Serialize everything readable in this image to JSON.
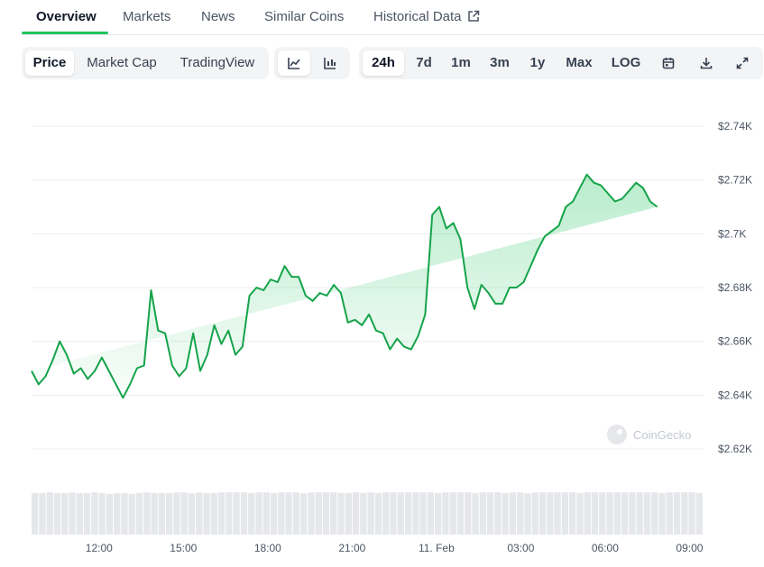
{
  "tabs": {
    "overview": "Overview",
    "markets": "Markets",
    "news": "News",
    "similar_coins": "Similar Coins",
    "historical_data": "Historical Data"
  },
  "toolbar": {
    "price": "Price",
    "market_cap": "Market Cap",
    "tradingview": "TradingView",
    "ranges": [
      "24h",
      "7d",
      "1m",
      "3m",
      "1y",
      "Max"
    ],
    "active_range": "24h",
    "log": "LOG",
    "icons": [
      "line-chart-icon",
      "candlestick-icon",
      "calendar-icon",
      "download-icon",
      "fullscreen-icon"
    ]
  },
  "watermark": "CoinGecko",
  "colors": {
    "line": "#16a34a",
    "accent": "#22c55e",
    "volume": "#e5e7eb"
  },
  "chart_data": {
    "type": "area",
    "title": "",
    "xlabel": "",
    "ylabel": "",
    "x_ticks": [
      "12:00",
      "15:00",
      "18:00",
      "21:00",
      "11. Feb",
      "03:00",
      "06:00",
      "09:00"
    ],
    "x_tick_hours": [
      12,
      15,
      18,
      21,
      24,
      27,
      30,
      33
    ],
    "xlim_hours": [
      9.6,
      33.5
    ],
    "y_ticks": [
      "$2.62K",
      "$2.64K",
      "$2.66K",
      "$2.68K",
      "$2.7K",
      "$2.72K",
      "$2.74K"
    ],
    "y_tick_values": [
      2620,
      2640,
      2660,
      2680,
      2700,
      2720,
      2740
    ],
    "ylim": [
      2620,
      2740
    ],
    "grid": true,
    "series": [
      {
        "x_hours": [
          9.6,
          9.85,
          10.1,
          10.35,
          10.6,
          10.85,
          11.1,
          11.35,
          11.6,
          11.85,
          12.1,
          12.35,
          12.6,
          12.85,
          13.1,
          13.35,
          13.6,
          13.85,
          14.1,
          14.35,
          14.6,
          14.85,
          15.1,
          15.35,
          15.6,
          15.85,
          16.1,
          16.35,
          16.6,
          16.85,
          17.1,
          17.35,
          17.6,
          17.85,
          18.1,
          18.35,
          18.6,
          18.85,
          19.1,
          19.35,
          19.6,
          19.85,
          20.1,
          20.35,
          20.6,
          20.85,
          21.1,
          21.35,
          21.6,
          21.85,
          22.1,
          22.35,
          22.6,
          22.85,
          23.1,
          23.35,
          23.6,
          23.85,
          24.1,
          24.35,
          24.6,
          24.85,
          25.1,
          25.35,
          25.6,
          25.85,
          26.1,
          26.35,
          26.6,
          26.85,
          27.1,
          27.35,
          27.6,
          27.85,
          28.1,
          28.35,
          28.6,
          28.85,
          29.1,
          29.35,
          29.6,
          29.85,
          30.1,
          30.35,
          30.6,
          30.85,
          31.1,
          31.35,
          31.6,
          31.85,
          32.1,
          32.35,
          32.6,
          32.85,
          33.1,
          33.5
        ],
        "values": [
          2649,
          2644,
          2647,
          2653,
          2660,
          2655,
          2648,
          2650,
          2646,
          2649,
          2654,
          2649,
          2644,
          2639,
          2644,
          2650,
          2651,
          2679,
          2664,
          2663,
          2651,
          2647,
          2650,
          2663,
          2649,
          2655,
          2666,
          2659,
          2664,
          2655,
          2658,
          2677,
          2680,
          2679,
          2683,
          2682,
          2688,
          2684,
          2684,
          2677,
          2675,
          2678,
          2677,
          2681,
          2678,
          2667,
          2668,
          2666,
          2670,
          2664,
          2663,
          2657,
          2661,
          2658,
          2657,
          2662,
          2670,
          2707,
          2710,
          2702,
          2704,
          2698,
          2680,
          2672,
          2681,
          2678,
          2674,
          2674,
          2680,
          2680,
          2682,
          2688,
          2694,
          2699,
          2701,
          2703,
          2710,
          2712,
          2717,
          2722,
          2719,
          2718,
          2715,
          2712,
          2713,
          2716,
          2719,
          2717,
          2712,
          2710
        ]
      }
    ],
    "volume": [
      52,
      52,
      53,
      52,
      52,
      53,
      52,
      52,
      53,
      52,
      51,
      52,
      52,
      51,
      52,
      53,
      52,
      52,
      52,
      53,
      53,
      52,
      53,
      52,
      52,
      53,
      53,
      53,
      53,
      52,
      53,
      53,
      52,
      53,
      53,
      53,
      52,
      53,
      53,
      53,
      53,
      52,
      52,
      53,
      52,
      53,
      52,
      53,
      53,
      53,
      53,
      53,
      53,
      53,
      52,
      53,
      53,
      53,
      53,
      52,
      53,
      53,
      53,
      52,
      53,
      53,
      52,
      53,
      53,
      53,
      53,
      53,
      53,
      52,
      53,
      53,
      53,
      53,
      53,
      53,
      53,
      53,
      53,
      53,
      52,
      53,
      53,
      53,
      53,
      52
    ]
  }
}
